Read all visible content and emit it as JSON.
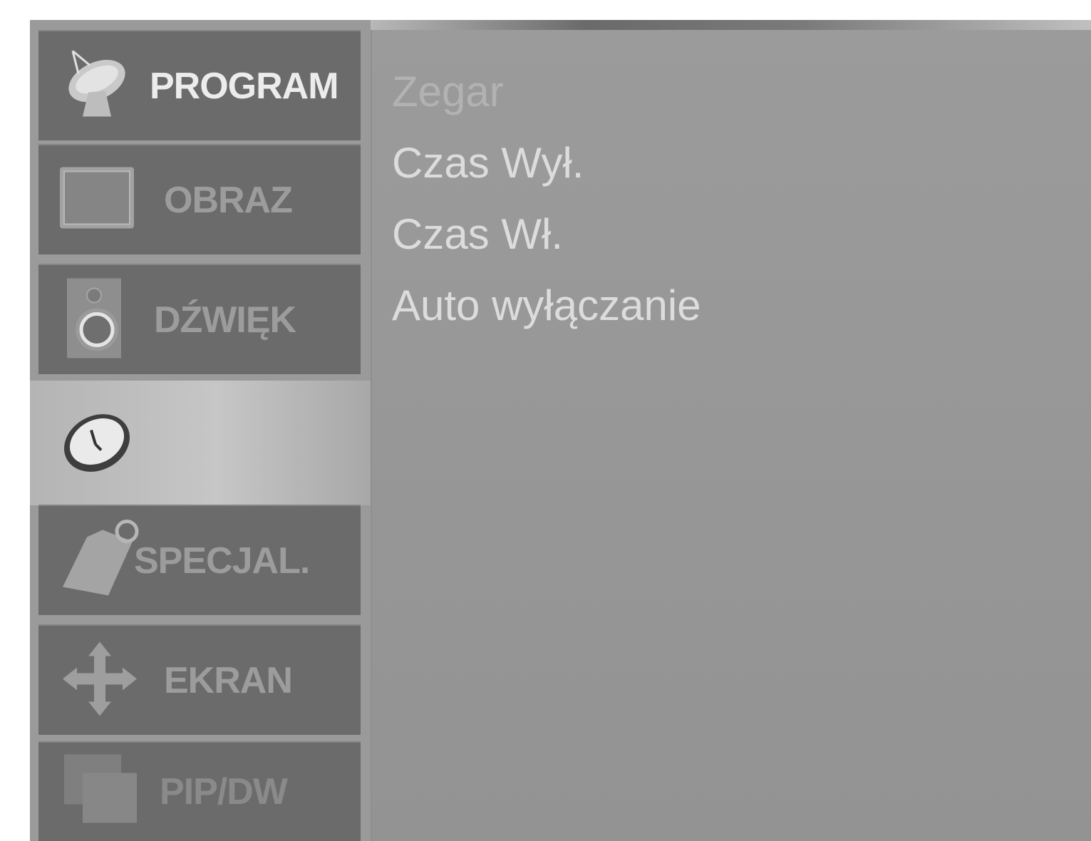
{
  "sidebar": {
    "tabs": [
      {
        "label": "PROGRAM",
        "icon": "satellite-dish-icon"
      },
      {
        "label": "OBRAZ",
        "icon": "tv-screen-icon"
      },
      {
        "label": "DŹWIĘK",
        "icon": "speaker-icon"
      },
      {
        "label": "",
        "icon": "clock-icon",
        "selected": true
      },
      {
        "label": "SPECJAL.",
        "icon": "tag-icon"
      },
      {
        "label": "EKRAN",
        "icon": "move-arrows-icon"
      },
      {
        "label": "PIP/DW",
        "icon": "pip-windows-icon"
      }
    ]
  },
  "submenu": {
    "items": [
      {
        "label": "Zegar"
      },
      {
        "label": "Czas Wył."
      },
      {
        "label": "Czas Wł."
      },
      {
        "label": "Auto wyłączanie"
      }
    ]
  },
  "colors": {
    "tab_background": "#6b6b6b",
    "selected_tab": "#c0c0c0",
    "content_background": "#969696",
    "text_light": "#dcdcdc"
  }
}
